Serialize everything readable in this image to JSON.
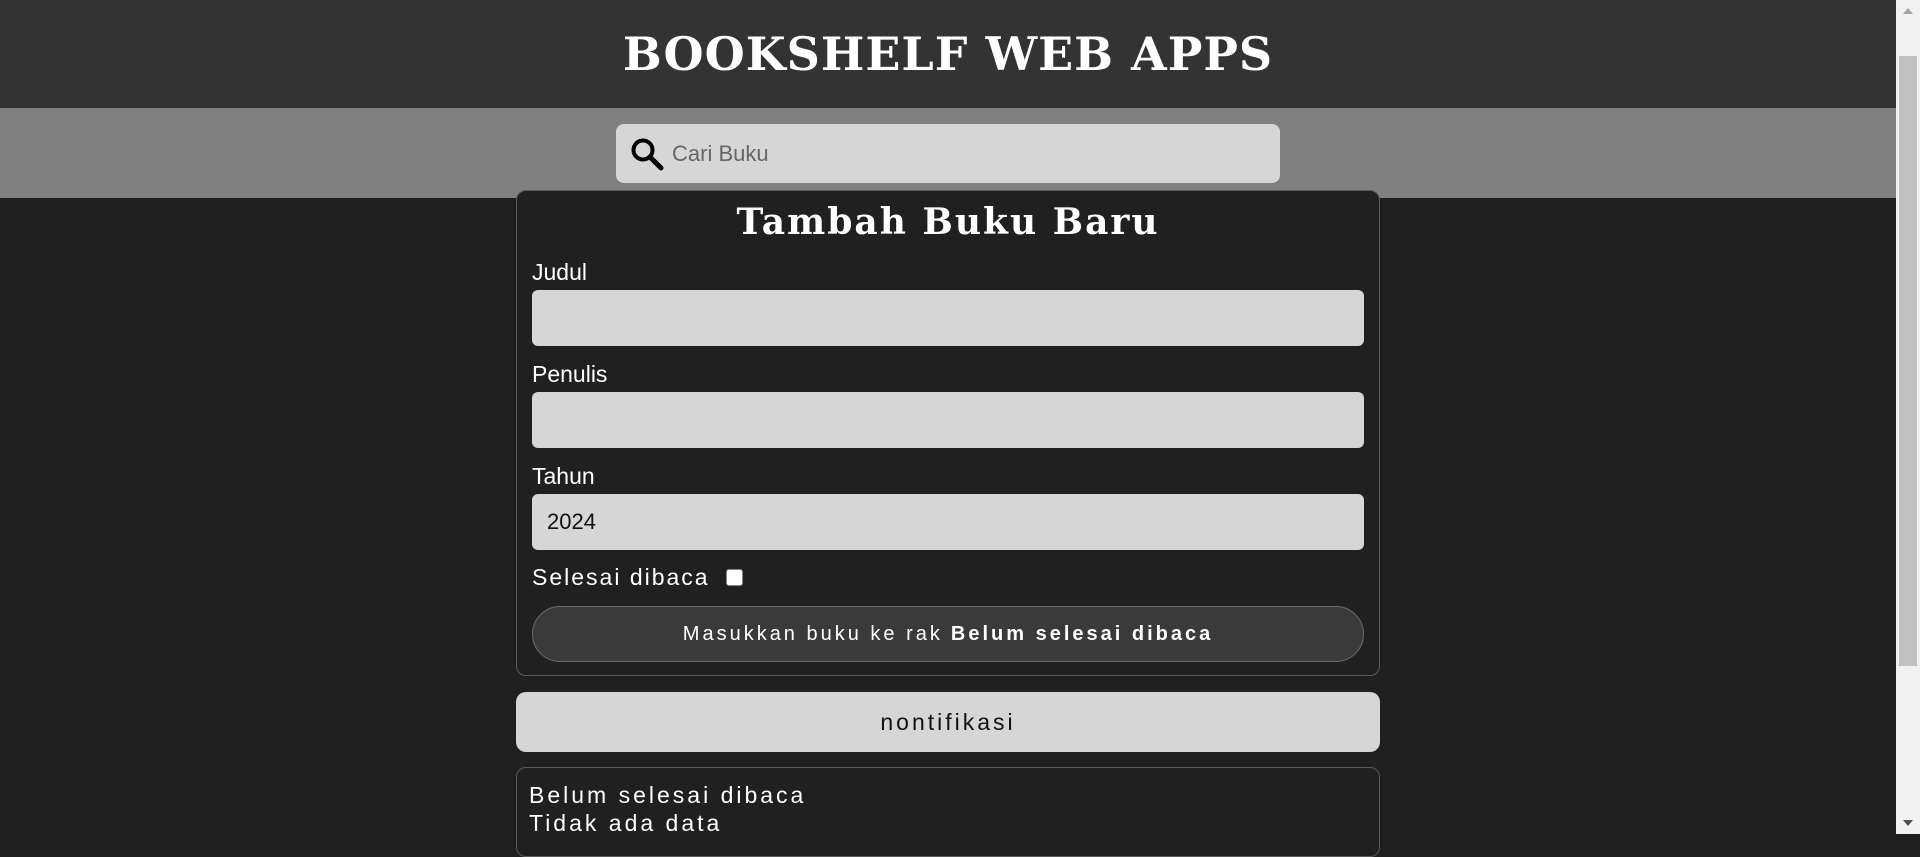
{
  "header": {
    "title": "BOOKSHELF WEB APPS"
  },
  "search": {
    "placeholder": "Cari Buku",
    "value": "",
    "icon": "search-icon"
  },
  "form": {
    "title": "Tambah Buku Baru",
    "fields": {
      "judul": {
        "label": "Judul",
        "value": ""
      },
      "penulis": {
        "label": "Penulis",
        "value": ""
      },
      "tahun": {
        "label": "Tahun",
        "value": "2024"
      }
    },
    "checkbox": {
      "label": "Selesai dibaca",
      "checked": false
    },
    "submit": {
      "prefix": "Masukkan buku ke rak",
      "shelf_name": "Belum selesai dibaca"
    }
  },
  "notification": {
    "label": "nontifikasi"
  },
  "shelf": {
    "title": "Belum selesai dibaca",
    "empty_text": "Tidak ada data"
  },
  "colors": {
    "background": "#202020",
    "header": "#333333",
    "search_bar": "#808080",
    "input": "#d6d6d6"
  }
}
